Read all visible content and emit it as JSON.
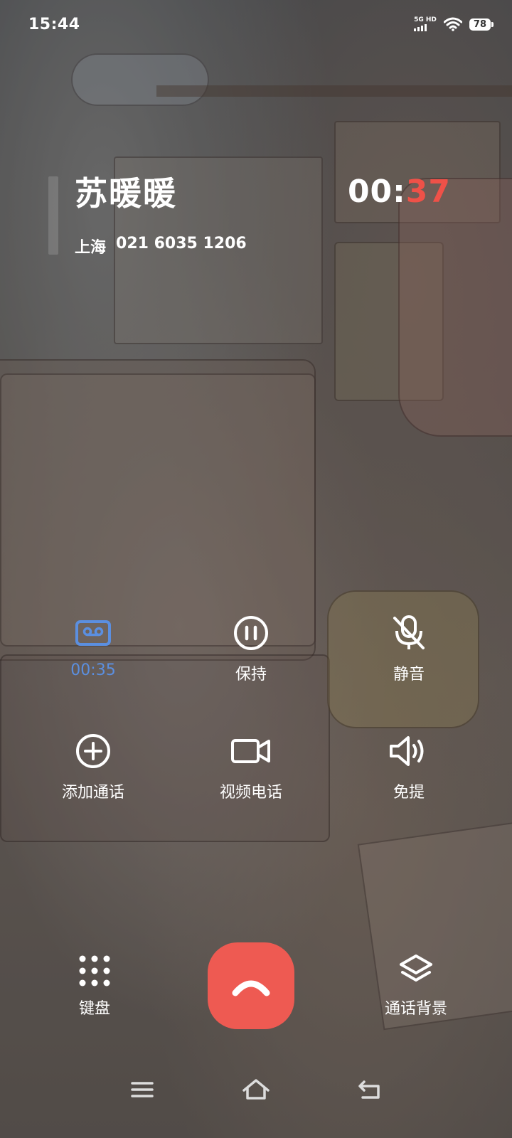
{
  "status_bar": {
    "time": "15:44",
    "network": "5G HD",
    "battery": "78"
  },
  "call": {
    "name": "苏暖暖",
    "location": "上海",
    "number": "021 6035 1206",
    "duration_min": "00:",
    "duration_sec": "37"
  },
  "actions": [
    {
      "label": "00:35",
      "icon": "recording-icon"
    },
    {
      "label": "保持",
      "icon": "pause-icon"
    },
    {
      "label": "静音",
      "icon": "mic-off-icon"
    },
    {
      "label": "添加通话",
      "icon": "add-call-icon"
    },
    {
      "label": "视频电话",
      "icon": "video-call-icon"
    },
    {
      "label": "免提",
      "icon": "speaker-icon"
    }
  ],
  "bottom": {
    "keypad_label": "键盘",
    "background_label": "通话背景"
  },
  "colors": {
    "hangup": "#ee5a52",
    "recording_accent": "#5b8fe0",
    "seconds_accent": "#ef5148"
  }
}
